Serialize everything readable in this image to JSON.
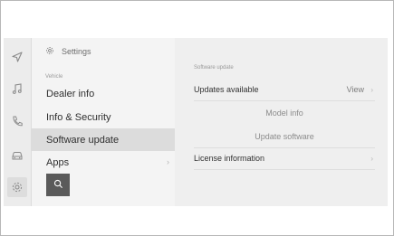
{
  "iconbar": {
    "items": [
      {
        "icon": "navigation-arrow-icon"
      },
      {
        "icon": "music-note-icon"
      },
      {
        "icon": "phone-icon"
      },
      {
        "icon": "car-icon"
      },
      {
        "icon": "gear-icon"
      }
    ]
  },
  "list": {
    "header": "Settings",
    "section_label": "Vehicle",
    "items": [
      {
        "label": "Dealer info"
      },
      {
        "label": "Info & Security"
      },
      {
        "label": "Software update"
      },
      {
        "label": "Apps",
        "chevron": "›"
      }
    ]
  },
  "detail": {
    "section_label": "Software update",
    "updates_available": {
      "label": "Updates available",
      "value": "View",
      "chevron": "›"
    },
    "model_info": "Model info",
    "update_software": "Update software",
    "license_information": {
      "label": "License information",
      "chevron": "›"
    }
  },
  "colors": {
    "selected_bg": "#dcdcdc",
    "search_button_bg": "#5a5a5a",
    "panel_bg": "#f0f0f0"
  }
}
